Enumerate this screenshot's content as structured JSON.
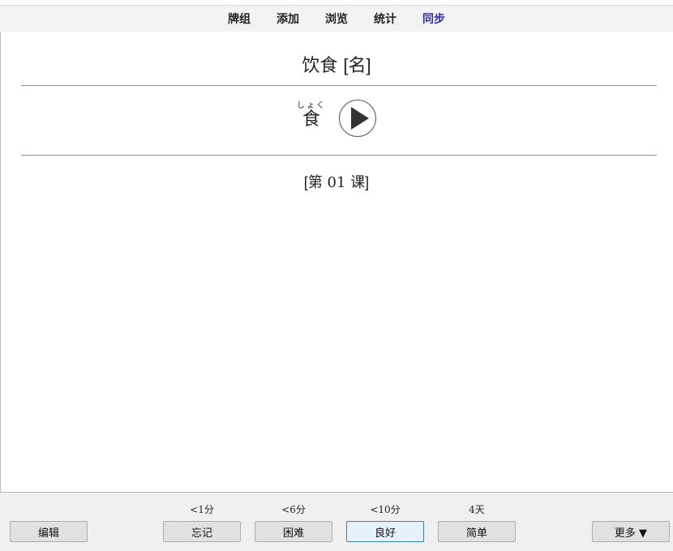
{
  "toolbar": {
    "decks": "牌组",
    "add": "添加",
    "browse": "浏览",
    "stats": "统计",
    "sync": "同步"
  },
  "card": {
    "front_word": "饮食",
    "front_tag": "[名]",
    "kanji": "食",
    "furigana": "しょく",
    "lesson": "第 01 课",
    "lesson_open": "[",
    "lesson_close": "]"
  },
  "bottom": {
    "edit_label": "编辑",
    "more_label": "更多 ▼",
    "answers": [
      {
        "time": "<1分",
        "label": "忘记"
      },
      {
        "time": "<6分",
        "label": "困难"
      },
      {
        "time": "<10分",
        "label": "良好"
      },
      {
        "time": "4天",
        "label": "简单"
      }
    ]
  },
  "icons": {
    "play": "play-circle-icon"
  },
  "colors": {
    "active_tab": "#2a2aa8",
    "toolbar_bg": "#f3f3f3",
    "bottom_bg": "#f0f0f0",
    "focused_border": "#3c7fb1"
  }
}
